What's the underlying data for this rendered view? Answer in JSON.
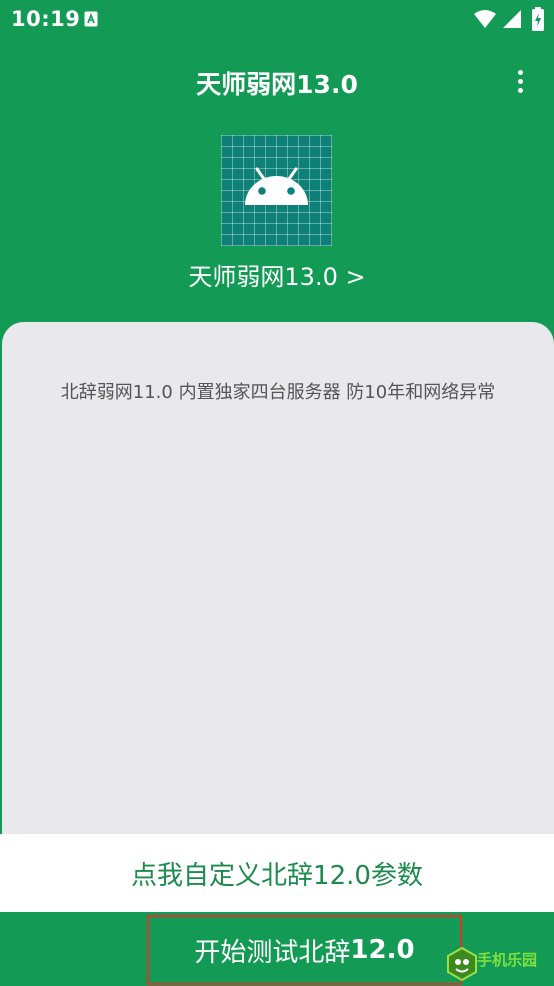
{
  "status_bar": {
    "time": "10:19",
    "notification_icon": "a-text-icon",
    "icons": [
      "wifi-icon",
      "cell-signal-icon",
      "battery-charging-icon"
    ]
  },
  "app_bar": {
    "title": "天师弱网13.0",
    "menu_icon": "more-vert-icon"
  },
  "header": {
    "app_icon": "android-icon",
    "version_link": "天师弱网13.0 >"
  },
  "content": {
    "description": "北辞弱网11.0 内置独家四台服务器 防10年和网络异常"
  },
  "custom_params": {
    "label": "点我自定义北辞12.0参数"
  },
  "start_button": {
    "label": "开始测试北辞",
    "version": "12.0"
  },
  "watermark": {
    "text": "手机乐园"
  },
  "colors": {
    "brand_green": "#139a55",
    "accent_text_green": "#1d8a4e",
    "card_background": "#e8e8ed",
    "highlight_border": "#d9362b"
  }
}
